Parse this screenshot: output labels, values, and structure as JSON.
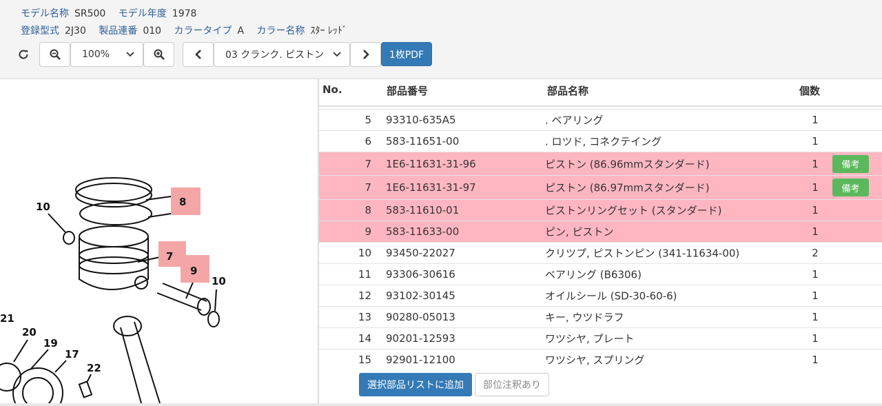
{
  "info": {
    "model_name_label": "モデル名称",
    "model_name": "SR500",
    "model_year_label": "モデル年度",
    "model_year": "1978",
    "reg_type_label": "登録型式",
    "reg_type": "2J30",
    "serial_label": "製品連番",
    "serial": "010",
    "color_type_label": "カラータイプ",
    "color_type": "A",
    "color_name_label": "カラー名称",
    "color_name": "ｽﾀｰ ﾚｯﾄﾞ"
  },
  "toolbar": {
    "zoom_value": "100%",
    "page_value": "03 クランク. ピストン",
    "pdf_label": "1枚PDF"
  },
  "table": {
    "headers": {
      "no": "No.",
      "part_no": "部品番号",
      "name": "部品名称",
      "qty": "個数"
    },
    "rows": [
      {
        "no": "5",
        "part_no": "93310-635A5",
        "name": ". ベアリング",
        "qty": "1",
        "highlight": false,
        "note": ""
      },
      {
        "no": "6",
        "part_no": "583-11651-00",
        "name": ". ロツド, コネクテイング",
        "qty": "1",
        "highlight": false,
        "note": ""
      },
      {
        "no": "7",
        "part_no": "1E6-11631-31-96",
        "name": "ピストン (86.96mmスタンダード)",
        "qty": "1",
        "highlight": true,
        "note": "備考"
      },
      {
        "no": "7",
        "part_no": "1E6-11631-31-97",
        "name": "ピストン (86.97mmスタンダード)",
        "qty": "1",
        "highlight": true,
        "note": "備考"
      },
      {
        "no": "8",
        "part_no": "583-11610-01",
        "name": "ピストンリングセット (スタンダード)",
        "qty": "1",
        "highlight": true,
        "note": ""
      },
      {
        "no": "9",
        "part_no": "583-11633-00",
        "name": "ピン, ピストン",
        "qty": "1",
        "highlight": true,
        "note": ""
      },
      {
        "no": "10",
        "part_no": "93450-22027",
        "name": "クリツプ, ピストンピン (341-11634-00)",
        "qty": "2",
        "highlight": false,
        "note": ""
      },
      {
        "no": "11",
        "part_no": "93306-30616",
        "name": "ベアリング (B6306)",
        "qty": "1",
        "highlight": false,
        "note": ""
      },
      {
        "no": "12",
        "part_no": "93102-30145",
        "name": "オイルシール (SD-30-60-6)",
        "qty": "1",
        "highlight": false,
        "note": ""
      },
      {
        "no": "13",
        "part_no": "90280-05013",
        "name": "キー, ウツドラフ",
        "qty": "1",
        "highlight": false,
        "note": ""
      },
      {
        "no": "14",
        "part_no": "90201-12593",
        "name": "ワツシヤ, プレート",
        "qty": "1",
        "highlight": false,
        "note": ""
      },
      {
        "no": "15",
        "part_no": "92901-12100",
        "name": "ワツシヤ, スプリング",
        "qty": "1",
        "highlight": false,
        "note": ""
      }
    ]
  },
  "actions": {
    "add_label": "選択部品リストに追加",
    "note_label": "部位注釈あり"
  },
  "diagram": {
    "callouts": [
      "10",
      "8",
      "7",
      "9",
      "10",
      "21",
      "20",
      "19",
      "17",
      "22"
    ],
    "highlight_color": "#f4a6a6"
  },
  "colors": {
    "accent": "#337ab7",
    "highlight_row": "#ffb6c1",
    "note_button": "#5cb85c"
  }
}
